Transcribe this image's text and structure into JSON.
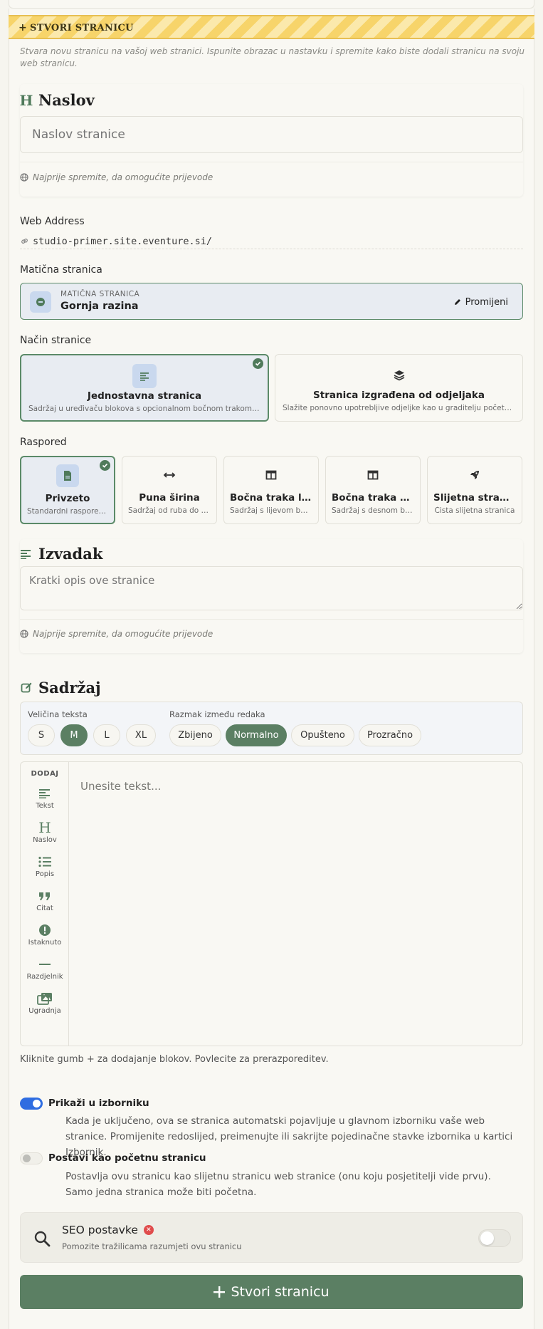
{
  "banner": {
    "label": "STVORI STRANICU"
  },
  "intro": "Stvara novu stranicu na vašoj web stranici. Ispunite obrazac u nastavku i spremite kako biste dodali stranicu na svoju web stranicu.",
  "title_section": {
    "heading": "Naslov",
    "input_placeholder": "Naslov stranice",
    "hint": "Najprije spremite, da omogućite prijevode"
  },
  "web_address": {
    "label": "Web Address",
    "value": "studio-primer.site.eventure.si/"
  },
  "parent_page": {
    "label": "Matična stranica",
    "small": "MATIČNA STRANICA",
    "value": "Gornja razina",
    "change_label": "Promijeni"
  },
  "page_mode": {
    "label": "Način stranice",
    "options": [
      {
        "title": "Jednostavna stranica",
        "desc": "Sadržaj u uređivaču blokova s opcionalnom bočnom trakom ili galerijom",
        "selected": true,
        "icon": "file-lines-icon"
      },
      {
        "title": "Stranica izgrađena od odjeljaka",
        "desc": "Slažite ponovno upotrebljive odjeljke kao u graditelju početne stranice",
        "selected": false,
        "icon": "layers-icon"
      }
    ]
  },
  "layout": {
    "label": "Raspored",
    "options": [
      {
        "title": "Privzeto",
        "desc": "Standardni raspored stranice",
        "selected": true,
        "icon": "file-icon"
      },
      {
        "title": "Puna širina",
        "desc": "Sadržaj od ruba do ruba",
        "selected": false,
        "icon": "arrows-horizontal-icon"
      },
      {
        "title": "Bočna traka lijevo",
        "desc": "Sadržaj s lijevom bočnom trakom",
        "selected": false,
        "icon": "columns-icon"
      },
      {
        "title": "Bočna traka desno",
        "desc": "Sadržaj s desnom bočnom trakom",
        "selected": false,
        "icon": "columns-icon"
      },
      {
        "title": "Slijetna stranica",
        "desc": "Čista slijetna stranica",
        "selected": false,
        "icon": "rocket-icon"
      }
    ]
  },
  "excerpt": {
    "heading": "Izvadak",
    "placeholder": "Kratki opis ove stranice",
    "hint": "Najprije spremite, da omogućite prijevode"
  },
  "content": {
    "heading": "Sadržaj",
    "text_size_label": "Veličina teksta",
    "text_sizes": [
      "S",
      "M",
      "L",
      "XL"
    ],
    "text_size_selected": "M",
    "line_spacing_label": "Razmak između redaka",
    "line_spacings": [
      "Zbijeno",
      "Normalno",
      "Opušteno",
      "Prozračno"
    ],
    "line_spacing_selected": "Normalno",
    "add_label": "DODAJ",
    "tools": [
      {
        "label": "Tekst",
        "icon": "text-align-icon"
      },
      {
        "label": "Naslov",
        "icon": "heading-icon"
      },
      {
        "label": "Popis",
        "icon": "list-icon"
      },
      {
        "label": "Citat",
        "icon": "quote-icon"
      },
      {
        "label": "Istaknuto",
        "icon": "exclamation-icon"
      },
      {
        "label": "Razdjelnik",
        "icon": "divider-icon"
      },
      {
        "label": "Ugradnja",
        "icon": "images-icon"
      }
    ],
    "editor_placeholder": "Unesite tekst...",
    "helper": "Kliknite gumb + za dodajanje blokov. Povlecite za prerazporeditev."
  },
  "menu_toggle": {
    "label": "Prikaži u izborniku",
    "on": true,
    "desc": "Kada je uključeno, ova se stranica automatski pojavljuje u glavnom izborniku vaše web stranice. Promijenite redoslijed, preimenujte ili sakrijte pojedinačne stavke izbornika u kartici Izbornik."
  },
  "home_toggle": {
    "label": "Postavi kao početnu stranicu",
    "on": false,
    "desc": "Postavlja ovu stranicu kao slijetnu stranicu web stranice (onu koju posjetitelji vide prvu). Samo jedna stranica može biti početna."
  },
  "seo": {
    "title": "SEO postavke",
    "desc": "Pomozite tražilicama razumjeti ovu stranicu",
    "enabled": false
  },
  "create_button": {
    "label": "Stvori stranicu"
  },
  "colors": {
    "accent": "#5b7f63",
    "toggle_on": "#2f6de1",
    "banner": "#f7d46a",
    "error": "#e04c4c"
  }
}
